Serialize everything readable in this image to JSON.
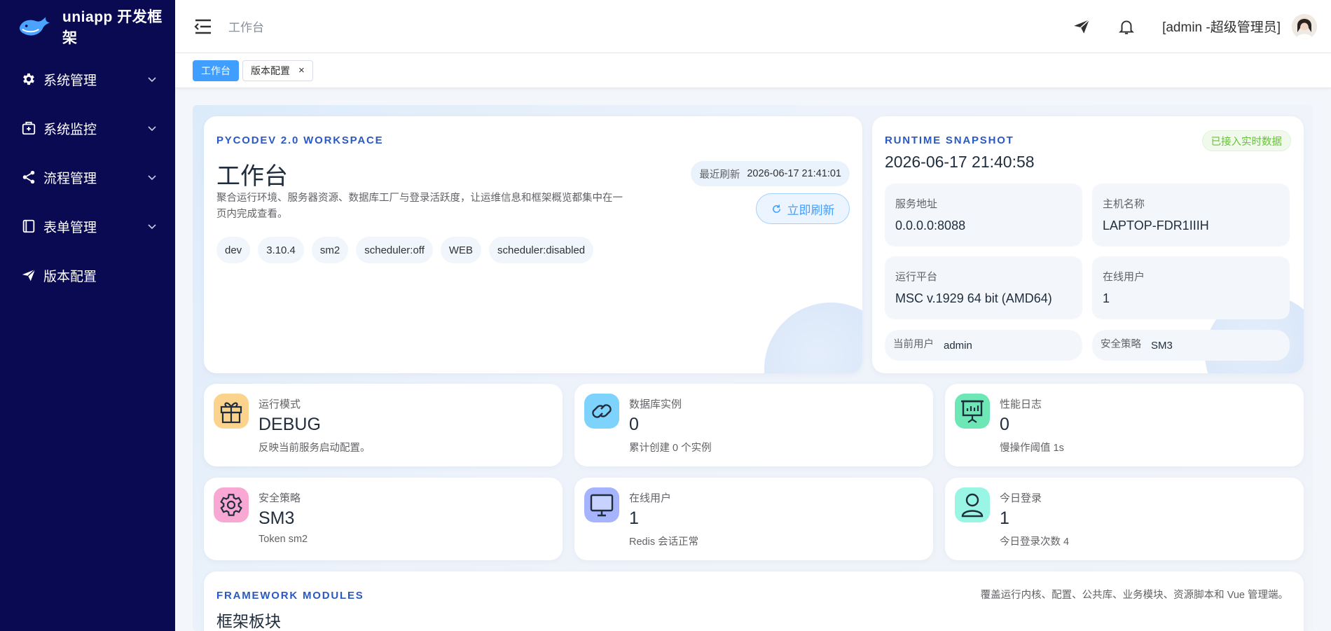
{
  "brand": {
    "title": "uniapp 开发框架"
  },
  "sidebar": {
    "items": [
      {
        "label": "系统管理",
        "icon": "gear-icon",
        "has_children": true
      },
      {
        "label": "系统监控",
        "icon": "monitor-box-icon",
        "has_children": true
      },
      {
        "label": "流程管理",
        "icon": "share-icon",
        "has_children": true
      },
      {
        "label": "表单管理",
        "icon": "form-icon",
        "has_children": true
      },
      {
        "label": "版本配置",
        "icon": "paper-plane-icon",
        "has_children": false
      }
    ]
  },
  "header": {
    "breadcrumb": "工作台",
    "user": "[admin -超级管理员]"
  },
  "tags": [
    {
      "label": "工作台",
      "active": true
    },
    {
      "label": "版本配置",
      "active": false,
      "closable": "×"
    }
  ],
  "hero": {
    "kicker": "PYCODEV 2.0 WORKSPACE",
    "title": "工作台",
    "description": "聚合运行环境、服务器资源、数据库工厂与登录活跃度，让运维信息和框架概览都集中在一页内完成查看。",
    "refresh_label": "最近刷新",
    "refresh_time": "2026-06-17 21:41:01",
    "refresh_button": "立即刷新",
    "chips": [
      "dev",
      "3.10.4",
      "sm2",
      "scheduler:off",
      "WEB",
      "scheduler:disabled"
    ]
  },
  "runtime": {
    "kicker": "RUNTIME SNAPSHOT",
    "time": "2026-06-17 21:40:58",
    "badge": "已接入实时数据",
    "service_addr_label": "服务地址",
    "service_addr": "0.0.0.0:8088",
    "host_label": "主机名称",
    "host": "LAPTOP-FDR1IIIH",
    "platform_label": "运行平台",
    "platform": "MSC v.1929 64 bit (AMD64)",
    "online_label": "在线用户",
    "online": "1",
    "current_user_label": "当前用户",
    "current_user": "admin",
    "security_label": "安全策略",
    "security": "SM3"
  },
  "stats": [
    {
      "label": "运行模式",
      "value": "DEBUG",
      "sub": "反映当前服务启动配置。",
      "icon": "gift-icon",
      "bg": "#fbd38d"
    },
    {
      "label": "数据库实例",
      "value": "0",
      "sub": "累计创建 0 个实例",
      "icon": "link-icon",
      "bg": "#7dd3fc"
    },
    {
      "label": "性能日志",
      "value": "0",
      "sub": "慢操作阈值 1s",
      "icon": "presentation-chart-icon",
      "bg": "#6ee7b7"
    },
    {
      "label": "安全策略",
      "value": "SM3",
      "sub": "Token sm2",
      "icon": "settings-cog-icon",
      "bg": "#f9a8d4"
    },
    {
      "label": "在线用户",
      "value": "1",
      "sub": "Redis 会话正常",
      "icon": "computer-monitor-icon",
      "bg": "#a5b4fc"
    },
    {
      "label": "今日登录",
      "value": "1",
      "sub": "今日登录次数 4",
      "icon": "user-icon",
      "bg": "#99f6e4"
    }
  ],
  "modules": {
    "kicker": "FRAMEWORK MODULES",
    "title": "框架板块",
    "description": "覆盖运行内核、配置、公共库、业务模块、资源脚本和 Vue 管理端。"
  },
  "colors": {
    "sidebar": "#0a0a52",
    "accent": "#409eff",
    "kicker": "#2b59c3",
    "success": "#67c23a"
  }
}
